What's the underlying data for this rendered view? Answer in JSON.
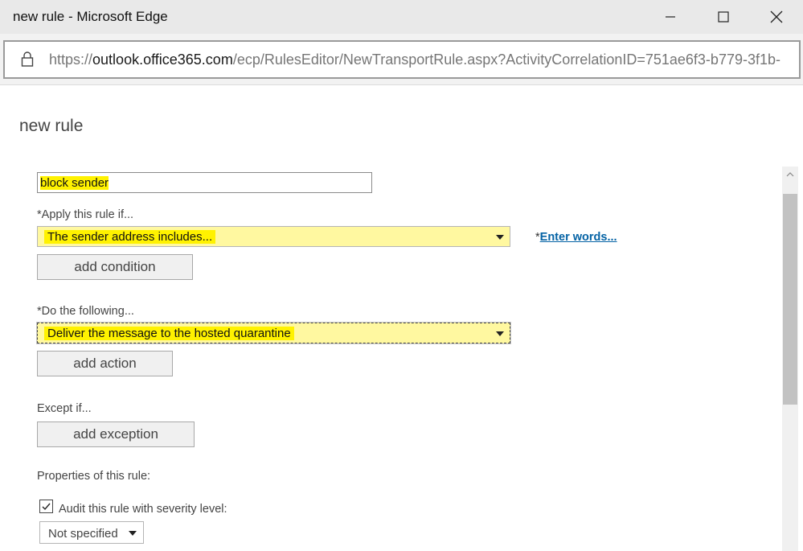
{
  "window": {
    "title": "new rule - Microsoft Edge"
  },
  "address_bar": {
    "url_prefix": "https://",
    "url_domain": "outlook.office365.com",
    "url_path": "/ecp/RulesEditor/NewTransportRule.aspx?ActivityCorrelationID=751ae6f3-b779-3f1b-"
  },
  "page": {
    "heading": "new rule"
  },
  "form": {
    "name_value": "block sender",
    "apply_label": "*Apply this rule if...",
    "apply_value": "The sender address includes...",
    "enter_words_prefix": "*",
    "enter_words_link": "Enter words...",
    "add_condition": "add condition",
    "do_label": "*Do the following...",
    "do_value": "Deliver the message to the hosted quarantine",
    "add_action": "add action",
    "except_label": "Except if...",
    "add_exception": "add exception",
    "properties_label": "Properties of this rule:",
    "audit_label": "Audit this rule with severity level:",
    "audit_checked": true,
    "severity_value": "Not specified"
  },
  "colors": {
    "highlight": "#fff200",
    "link": "#0563a5",
    "titlebar": "#e9e9e9"
  }
}
